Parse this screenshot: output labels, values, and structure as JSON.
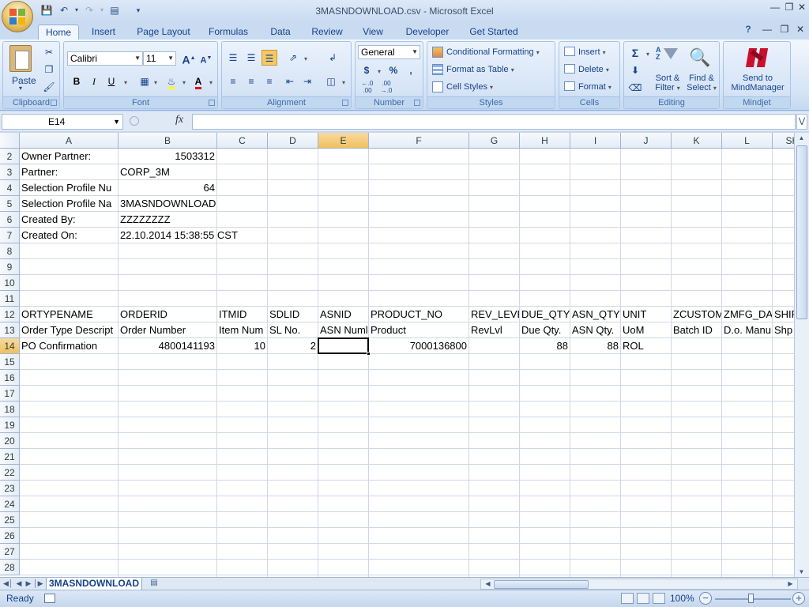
{
  "window": {
    "title": "3MASNDOWNLOAD.csv - Microsoft Excel"
  },
  "tabs": [
    "Home",
    "Insert",
    "Page Layout",
    "Formulas",
    "Data",
    "Review",
    "View",
    "Developer",
    "Get Started"
  ],
  "ribbon": {
    "clipboard": {
      "label": "Clipboard",
      "paste": "Paste"
    },
    "font": {
      "label": "Font",
      "name": "Calibri",
      "size": "11",
      "bold": "B",
      "italic": "I",
      "underline": "U",
      "grow": "A",
      "shrink": "A"
    },
    "alignment": {
      "label": "Alignment"
    },
    "number": {
      "label": "Number",
      "format": "General",
      "currency": "$",
      "percent": "%",
      "comma": ",",
      "inc_decimal": "←.0 .00",
      "dec_decimal": ".00 →.0"
    },
    "styles": {
      "label": "Styles",
      "conditional": "Conditional Formatting",
      "format_table": "Format as Table",
      "cell_styles": "Cell Styles"
    },
    "cells": {
      "label": "Cells",
      "insert": "Insert",
      "delete": "Delete",
      "format": "Format"
    },
    "editing": {
      "label": "Editing",
      "sum": "Σ",
      "sort_filter_1": "Sort &",
      "sort_filter_2": "Filter",
      "find_select_1": "Find &",
      "find_select_2": "Select"
    },
    "mindjet": {
      "label": "Mindjet",
      "send_1": "Send to",
      "send_2": "MindManager"
    }
  },
  "formula_bar": {
    "name_box": "E14",
    "fx": "fx",
    "value": ""
  },
  "columns": [
    "A",
    "B",
    "C",
    "D",
    "E",
    "F",
    "G",
    "H",
    "I",
    "J",
    "K",
    "L",
    "SHIP"
  ],
  "rows": [
    "2",
    "3",
    "4",
    "5",
    "6",
    "7",
    "8",
    "9",
    "10",
    "11",
    "12",
    "13",
    "14",
    "15",
    "16",
    "17",
    "18",
    "19",
    "20",
    "21",
    "22",
    "23",
    "24",
    "25",
    "26",
    "27",
    "28"
  ],
  "cells": {
    "A2": "Owner Partner:",
    "B2": "1503312",
    "A3": "Partner:",
    "B3": "CORP_3M",
    "A4": "Selection Profile Nu",
    "B4": "64",
    "A5": "Selection Profile Na",
    "B5": "3MASNDOWNLOAD",
    "A6": "Created By:",
    "B6": "ZZZZZZZZ",
    "A7": "Created On:",
    "B7": "22.10.2014 15:38:55 CST",
    "A12": "ORTYPENAME",
    "B12": "ORDERID",
    "C12": "ITMID",
    "D12": "SDLID",
    "E12": "ASNID",
    "F12": "PRODUCT_NO",
    "G12": "REV_LEVE",
    "H12": "DUE_QTY",
    "I12": "ASN_QTY",
    "J12": "UNIT",
    "K12": "ZCUSTOM",
    "L12": "ZMFG_DA",
    "M12": "SHIP",
    "A13": "Order Type Descript",
    "B13": "Order Number",
    "C13": "Item Num",
    "D13": "SL No.",
    "E13": "ASN Numl",
    "F13": "Product",
    "G13": "RevLvl",
    "H13": "Due Qty.",
    "I13": "ASN Qty.",
    "J13": "UoM",
    "K13": "Batch ID",
    "L13": "D.o. Manu",
    "M13": "Shp",
    "A14": "PO Confirmation",
    "B14": "4800141193",
    "C14": "10",
    "D14": "2",
    "F14": "7000136800",
    "H14": "88",
    "I14": "88",
    "J14": "ROL"
  },
  "sheet_tab": "3MASNDOWNLOAD",
  "status": {
    "text": "Ready",
    "zoom": "100%"
  },
  "colors": {
    "selected_header": "#f1c15f",
    "ribbon_bg": "#dbe7f6",
    "grid_line": "#d0d7e5"
  }
}
